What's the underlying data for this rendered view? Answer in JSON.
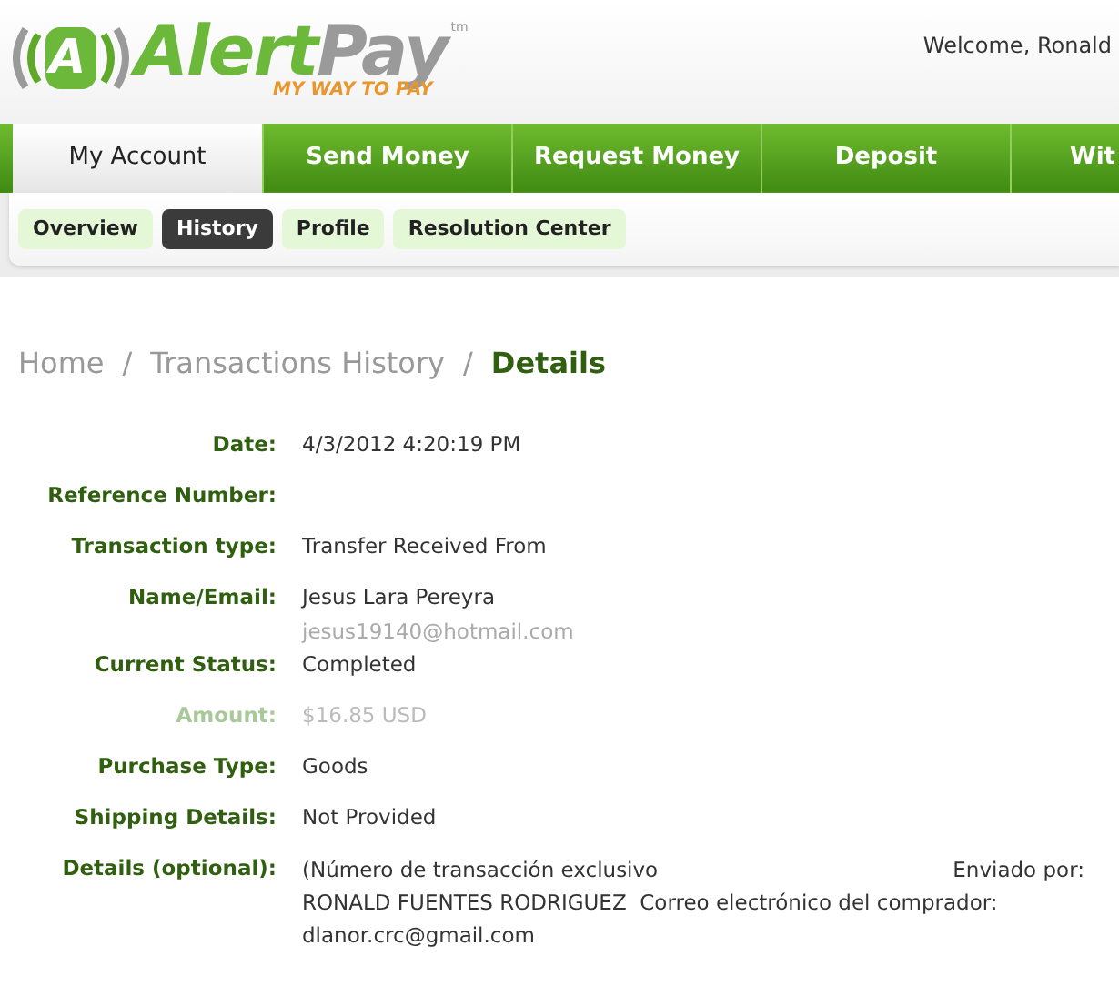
{
  "logo": {
    "mark": "A",
    "name_first": "Alert",
    "name_second": "Pay",
    "trademark": "tm",
    "tagline": "MY WAY TO PAY"
  },
  "welcome": "Welcome, Ronald",
  "nav_tabs": [
    {
      "label": "My Account",
      "selected": true
    },
    {
      "label": "Send Money",
      "selected": false
    },
    {
      "label": "Request Money",
      "selected": false
    },
    {
      "label": "Deposit",
      "selected": false
    },
    {
      "label": "Wit",
      "selected": false
    }
  ],
  "sub_tabs": [
    {
      "label": "Overview",
      "selected": false
    },
    {
      "label": "History",
      "selected": true
    },
    {
      "label": "Profile",
      "selected": false
    },
    {
      "label": "Resolution Center",
      "selected": false
    }
  ],
  "breadcrumb": [
    {
      "label": "Home",
      "current": false
    },
    {
      "label": "Transactions History",
      "current": false
    },
    {
      "label": "Details",
      "current": true
    }
  ],
  "breadcrumb_separator": "/",
  "details": [
    {
      "kind": "text",
      "label": "Date:",
      "value": "4/3/2012 4:20:19 PM",
      "dimmed": false
    },
    {
      "kind": "text",
      "label": "Reference Number:",
      "dimmed": false
    },
    {
      "kind": "text",
      "label": "Transaction type:",
      "value": "Transfer Received From",
      "dimmed": false
    },
    {
      "kind": "contact",
      "label": "Name/Email:",
      "value": "Jesus Lara Pereyra",
      "email": "jesus19140@hotmail.com",
      "dimmed": false
    },
    {
      "kind": "text",
      "label": "Current Status:",
      "value": "Completed",
      "dimmed": false
    },
    {
      "kind": "text",
      "label": "Amount:",
      "value": "$16.85 USD",
      "dimmed": true
    },
    {
      "kind": "text",
      "label": "Purchase Type:",
      "value": "Goods",
      "dimmed": false
    },
    {
      "kind": "text",
      "label": "Shipping Details:",
      "value": "Not Provided",
      "dimmed": false
    },
    {
      "kind": "note",
      "label": "Details (optional):",
      "lines": [
        [
          "(Número de transacción exclusivo",
          "Enviado por:"
        ],
        [
          "RONALD FUENTES RODRIGUEZ  Correo electrónico del comprador:"
        ],
        [
          "dlanor.crc@gmail.com"
        ]
      ],
      "dimmed": false
    }
  ]
}
